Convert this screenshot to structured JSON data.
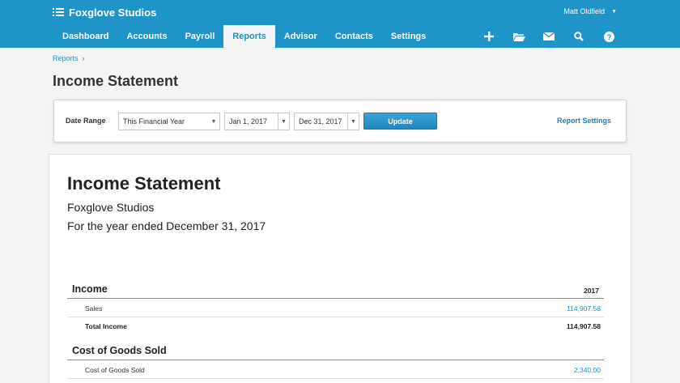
{
  "header": {
    "org_name": "Foxglove Studios",
    "user_name": "Matt Oldfield",
    "brand_color": "#1f94c9",
    "nav": [
      {
        "label": "Dashboard",
        "active": false
      },
      {
        "label": "Accounts",
        "active": false
      },
      {
        "label": "Payroll",
        "active": false
      },
      {
        "label": "Reports",
        "active": true
      },
      {
        "label": "Advisor",
        "active": false
      },
      {
        "label": "Contacts",
        "active": false
      },
      {
        "label": "Settings",
        "active": false
      }
    ],
    "icons": [
      "plus-icon",
      "folder-icon",
      "mail-icon",
      "search-icon",
      "help-icon"
    ]
  },
  "breadcrumb": {
    "item": "Reports",
    "separator": "›"
  },
  "page_title": "Income Statement",
  "filters": {
    "date_range_label": "Date Range",
    "period_value": "This Financial Year",
    "from_date": "Jan 1, 2017",
    "to_date": "Dec 31, 2017",
    "update_label": "Update",
    "settings_label": "Report Settings"
  },
  "report": {
    "title": "Income Statement",
    "organization": "Foxglove Studios",
    "period": "For the year ended December 31, 2017",
    "sections": [
      {
        "name": "Income",
        "year": "2017",
        "rows": [
          {
            "label": "Sales",
            "amount": "114,907.58"
          },
          {
            "label": "Total Income",
            "amount": "114,907.58"
          }
        ]
      },
      {
        "name": "Cost of Goods Sold",
        "rows": [
          {
            "label": "Cost of Goods Sold",
            "amount": "2,340.00"
          }
        ]
      }
    ]
  }
}
